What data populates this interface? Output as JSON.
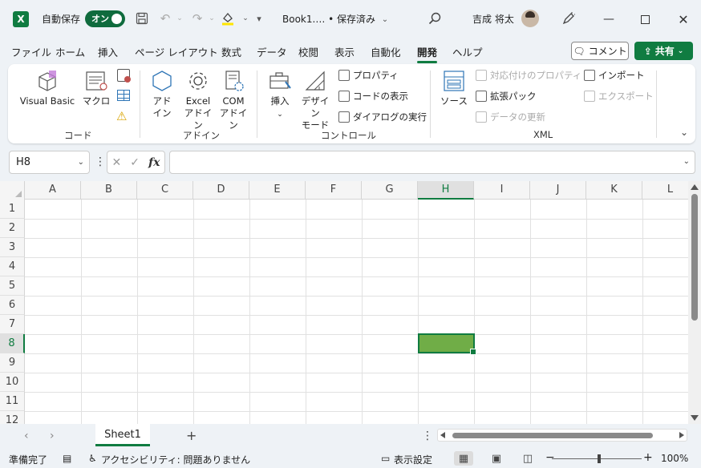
{
  "titlebar": {
    "app_logo": "X",
    "autosave_label": "自動保存",
    "autosave_toggle": "オン",
    "doc_title": "Book1.… • 保存済み",
    "user_name": "吉成 将太",
    "icons": [
      "save-icon",
      "undo-icon",
      "redo-icon",
      "fill-color-icon",
      "customize-icon",
      "search-icon",
      "pen-icon",
      "minimize-icon",
      "maximize-icon",
      "close-icon"
    ]
  },
  "tabs": {
    "items": [
      "ファイル",
      "ホーム",
      "挿入",
      "ページ レイアウト",
      "数式",
      "データ",
      "校閲",
      "表示",
      "自動化",
      "開発",
      "ヘルプ"
    ],
    "active": "開発",
    "comment_label": "コメント",
    "share_label": "共有"
  },
  "ribbon": {
    "code": {
      "visual_basic": "Visual Basic",
      "macro": "マクロ",
      "label": "コード"
    },
    "addins": {
      "addin_line1": "アド",
      "addin_line2": "イン",
      "excel_line1": "Excel",
      "excel_line2": "アドイン",
      "com_line1": "COM",
      "com_line2": "アドイン",
      "label": "アドイン"
    },
    "controls": {
      "insert": "挿入",
      "design_line1": "デザイン",
      "design_line2": "モード",
      "properties": "プロパティ",
      "view_code": "コードの表示",
      "run_dialog": "ダイアログの実行",
      "label": "コントロール"
    },
    "xml": {
      "source": "ソース",
      "map_properties": "対応付けのプロパティ",
      "expansion_packs": "拡張パック",
      "refresh_data": "データの更新",
      "import": "インポート",
      "export": "エクスポート",
      "label": "XML"
    }
  },
  "formula_bar": {
    "name_box": "H8",
    "fx_label": "fx",
    "formula_value": ""
  },
  "grid": {
    "columns": [
      "A",
      "B",
      "C",
      "D",
      "E",
      "F",
      "G",
      "H",
      "I",
      "J",
      "K",
      "L"
    ],
    "rows": [
      "1",
      "2",
      "3",
      "4",
      "5",
      "6",
      "7",
      "8",
      "9",
      "10",
      "11",
      "12"
    ],
    "selected_cell": "H8",
    "selected_fill": "#70ad47"
  },
  "sheets": {
    "tabs": [
      "Sheet1"
    ],
    "active": "Sheet1",
    "add_label": "+"
  },
  "status": {
    "ready": "準備完了",
    "accessibility": "アクセシビリティ: 問題ありません",
    "display_settings": "表示設定",
    "zoom": "100%"
  },
  "colors": {
    "accent": "#107c41"
  }
}
